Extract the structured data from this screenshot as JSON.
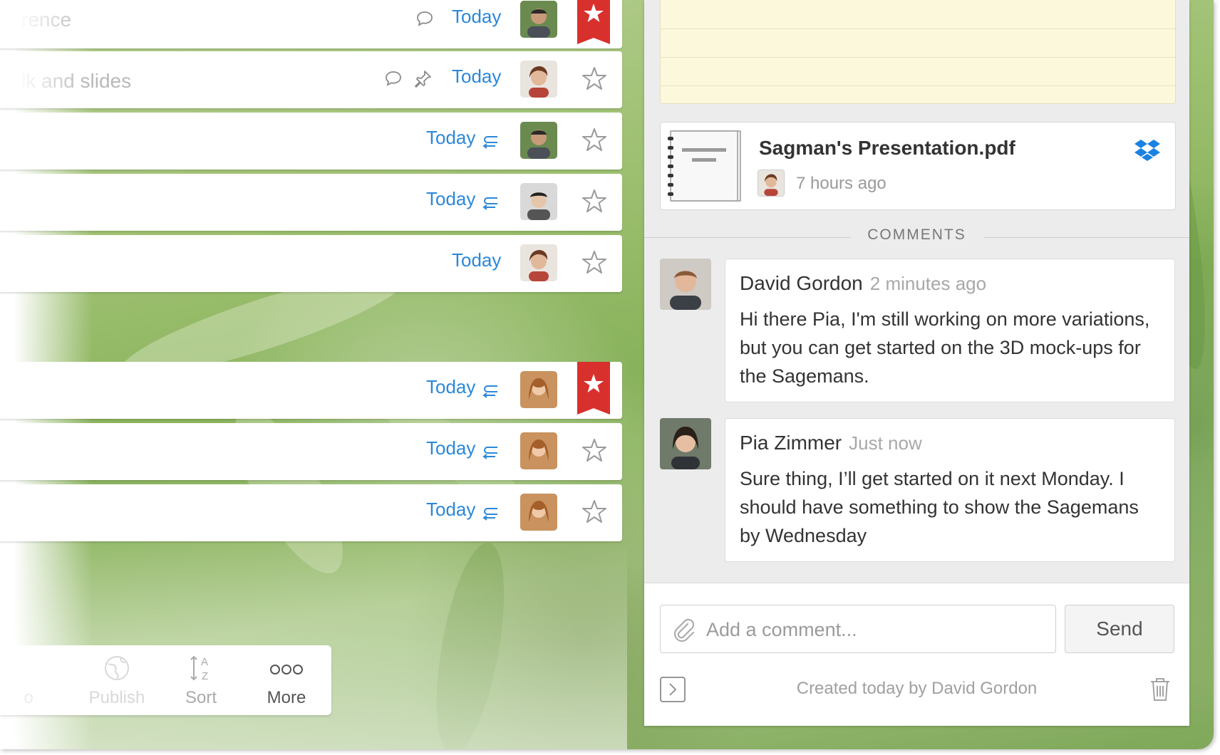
{
  "tasks": [
    {
      "title": "rence",
      "due": "Today",
      "icons": [
        "comment-icon"
      ],
      "starred": true
    },
    {
      "title": "lk and slides",
      "due": "Today",
      "icons": [
        "comment-icon",
        "pin-icon"
      ],
      "starred": false
    },
    {
      "title": "",
      "due": "Today",
      "icons": [
        "recurring-icon"
      ],
      "starred": false
    },
    {
      "title": "",
      "due": "Today",
      "icons": [
        "recurring-icon"
      ],
      "starred": false
    },
    {
      "title": "",
      "due": "Today",
      "icons": [],
      "starred": false
    },
    {
      "title": "",
      "due": "Today",
      "icons": [
        "recurring-icon"
      ],
      "starred": true
    },
    {
      "title": "",
      "due": "Today",
      "icons": [
        "recurring-icon"
      ],
      "starred": false
    },
    {
      "title": "",
      "due": "Today",
      "icons": [
        "recurring-icon"
      ],
      "starred": false
    }
  ],
  "toolbar": {
    "partial_label": "o",
    "publish_label": "Publish",
    "sort_label": "Sort",
    "more_label": "More"
  },
  "detail": {
    "file": {
      "name": "Sagman's Presentation.pdf",
      "time": "7 hours ago",
      "source_icon": "dropbox-icon"
    },
    "comments_heading": "COMMENTS",
    "comments": [
      {
        "author": "David Gordon",
        "time": "2 minutes ago",
        "text": "Hi there Pia, I'm still working on more variations, but you can get started on the 3D mock-ups for the Sagemans."
      },
      {
        "author": "Pia Zimmer",
        "time": "Just now",
        "text": "Sure thing, I’ll get started on it next Monday. I should have something to show the Sagemans by Wednesday"
      }
    ],
    "composer": {
      "placeholder": "Add a comment...",
      "send_label": "Send"
    },
    "footer": {
      "created_by": "Created today by David Gordon"
    }
  },
  "colors": {
    "accent_blue": "#2b88d9",
    "star_red": "#d8302c",
    "note_yellow": "#fbf8dc"
  }
}
